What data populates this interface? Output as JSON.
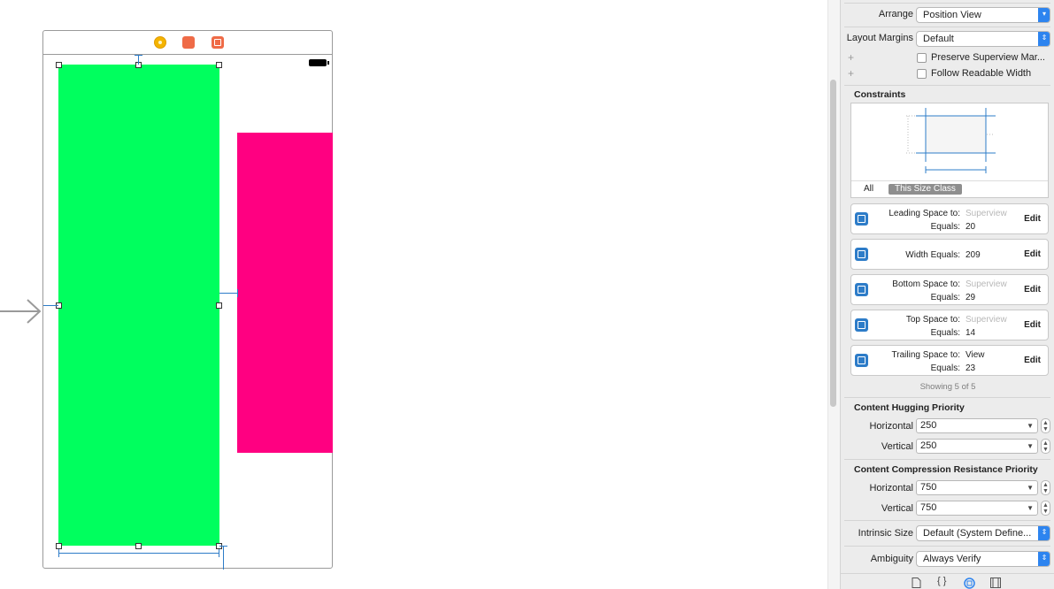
{
  "inspector": {
    "arrange": {
      "label": "Arrange",
      "value": "Position View"
    },
    "layout_margins": {
      "label": "Layout Margins",
      "value": "Default"
    },
    "preserve_superview": {
      "label": "Preserve Superview Mar..."
    },
    "follow_readable": {
      "label": "Follow Readable Width"
    },
    "constraints_title": "Constraints",
    "size_class": {
      "all": "All",
      "this_size_class": "This Size Class"
    },
    "constraints": [
      {
        "key": "Leading Space to:",
        "target": "Superview",
        "equals_label": "Equals:",
        "value": "20",
        "edit": "Edit"
      },
      {
        "key": "Width Equals:",
        "value": "209",
        "edit": "Edit"
      },
      {
        "key": "Bottom Space to:",
        "target": "Superview",
        "equals_label": "Equals:",
        "value": "29",
        "edit": "Edit"
      },
      {
        "key": "Top Space to:",
        "target": "Superview",
        "equals_label": "Equals:",
        "value": "14",
        "edit": "Edit"
      },
      {
        "key": "Trailing Space to:",
        "target": "View",
        "equals_label": "Equals:",
        "value": "23",
        "edit": "Edit"
      }
    ],
    "showing": "Showing 5 of 5",
    "hugging": {
      "title": "Content Hugging Priority",
      "horizontal_label": "Horizontal",
      "horizontal": "250",
      "vertical_label": "Vertical",
      "vertical": "250"
    },
    "compression": {
      "title": "Content Compression Resistance Priority",
      "horizontal_label": "Horizontal",
      "horizontal": "750",
      "vertical_label": "Vertical",
      "vertical": "750"
    },
    "intrinsic_size": {
      "label": "Intrinsic Size",
      "value": "Default (System Define..."
    },
    "ambiguity": {
      "label": "Ambiguity",
      "value": "Always Verify"
    }
  },
  "colors": {
    "green_view": "#00ff5e",
    "pink_view": "#ff0081",
    "constraint": "#2d7cc8",
    "accent": "#2d84ef"
  },
  "icons": [
    "view-controller-icon",
    "first-responder-icon",
    "exit-icon",
    "battery-icon",
    "file-inspector-icon",
    "quick-help-icon",
    "size-inspector-icon",
    "identity-inspector-icon"
  ]
}
